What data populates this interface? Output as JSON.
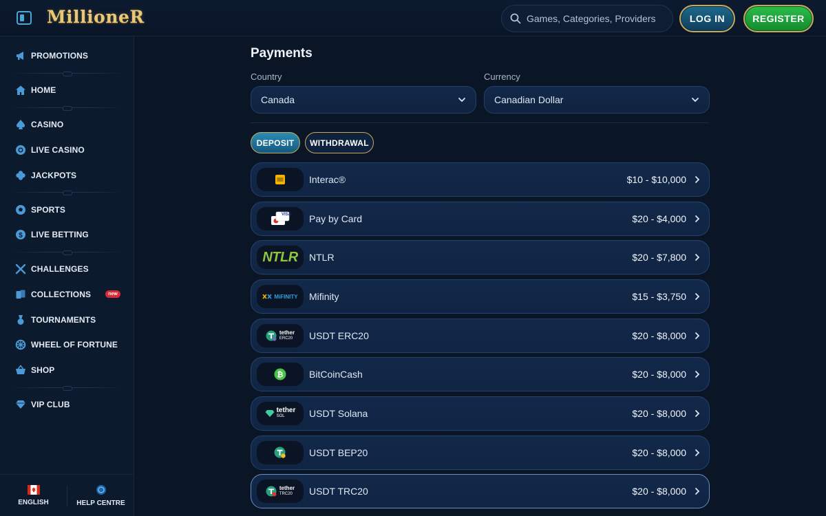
{
  "header": {
    "logo_text": "MillioneR",
    "search_placeholder": "Games, Categories, Providers",
    "login_label": "LOG IN",
    "register_label": "REGISTER"
  },
  "sidebar": {
    "items": [
      {
        "label": "PROMOTIONS",
        "icon": "megaphone-icon"
      },
      {
        "label": "HOME",
        "icon": "home-icon"
      },
      {
        "label": "CASINO",
        "icon": "spade-icon"
      },
      {
        "label": "LIVE CASINO",
        "icon": "chip-icon"
      },
      {
        "label": "JACKPOTS",
        "icon": "clover-icon"
      },
      {
        "label": "SPORTS",
        "icon": "ball-icon"
      },
      {
        "label": "LIVE BETTING",
        "icon": "coin-icon"
      },
      {
        "label": "CHALLENGES",
        "icon": "swords-icon"
      },
      {
        "label": "COLLECTIONS",
        "icon": "cards-icon",
        "badge": "new"
      },
      {
        "label": "TOURNAMENTS",
        "icon": "medal-icon"
      },
      {
        "label": "WHEEL OF FORTUNE",
        "icon": "wheel-icon"
      },
      {
        "label": "SHOP",
        "icon": "basket-icon"
      },
      {
        "label": "VIP CLUB",
        "icon": "diamond-icon"
      }
    ],
    "footer": {
      "language_label": "ENGLISH",
      "help_label": "HELP CENTRE"
    }
  },
  "main": {
    "title": "Payments",
    "country_label": "Country",
    "country_value": "Canada",
    "currency_label": "Currency",
    "currency_value": "Canadian Dollar",
    "tabs": {
      "deposit": "DEPOSIT",
      "withdrawal": "WITHDRAWAL"
    },
    "methods": [
      {
        "name": "Interac®",
        "range": "$10 - $10,000"
      },
      {
        "name": "Pay by Card",
        "range": "$20 - $4,000",
        "logo_text": "VISA"
      },
      {
        "name": "NTLR",
        "range": "$20 - $7,800",
        "logo_text": "NTLR"
      },
      {
        "name": "Mifinity",
        "range": "$15 - $3,750",
        "logo_text": "MiFINITY"
      },
      {
        "name": "USDT ERC20",
        "range": "$20 - $8,000",
        "logo_text": "tether",
        "logo_sub": "ERC20"
      },
      {
        "name": "BitCoinCash",
        "range": "$20 - $8,000"
      },
      {
        "name": "USDT Solana",
        "range": "$20 - $8,000",
        "logo_text": "tether",
        "logo_sub": "SOL"
      },
      {
        "name": "USDT BEP20",
        "range": "$20 - $8,000"
      },
      {
        "name": "USDT TRC20",
        "range": "$20 - $8,000",
        "logo_text": "tether",
        "logo_sub": "TRC20"
      }
    ]
  },
  "colors": {
    "background": "#0a1526",
    "sidebar": "#0c1a2e",
    "accent_blue": "#2b8db6",
    "accent_green": "#2bbd4c",
    "gold_border": "#c9a95c",
    "badge_red": "#d92a36"
  }
}
